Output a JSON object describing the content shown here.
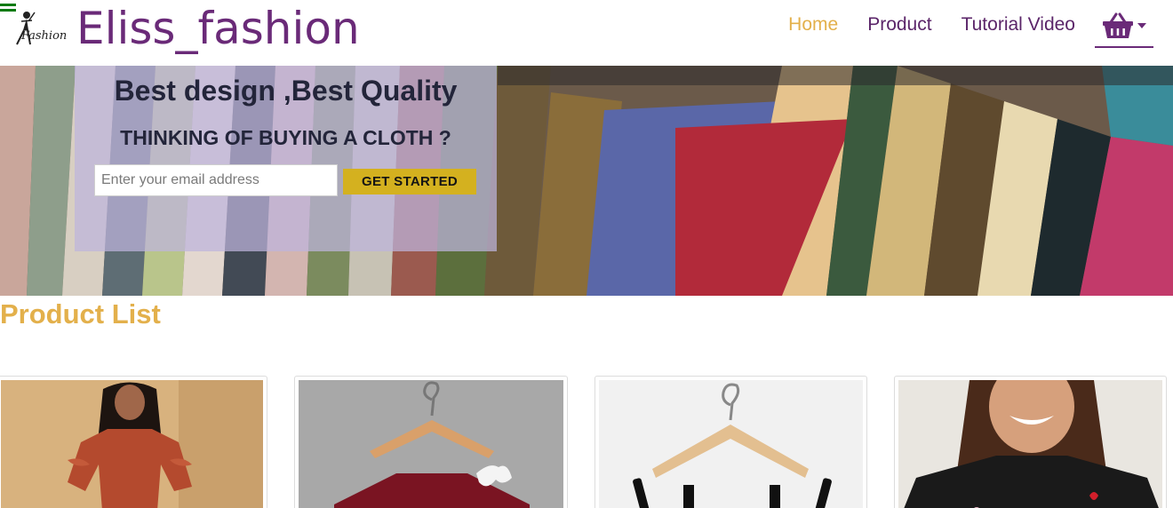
{
  "navbar": {
    "brand": "Eliss_fashion",
    "logo_text": "Fashion",
    "links": [
      {
        "label": "Home",
        "active": true
      },
      {
        "label": "Product",
        "active": false
      },
      {
        "label": "Tutorial Video",
        "active": false
      }
    ],
    "cart_icon": "shopping-basket-icon"
  },
  "hero": {
    "title": "Best design ,Best Quality",
    "subtitle": "THINKING OF BUYING A CLOTH ?",
    "email_placeholder": "Enter your email address",
    "email_value": "",
    "cta_label": "GET STARTED"
  },
  "products": {
    "heading": "Product List"
  },
  "colors": {
    "brand": "#6a2a78",
    "accent": "#e3b04b",
    "cta": "#d4b11f"
  }
}
